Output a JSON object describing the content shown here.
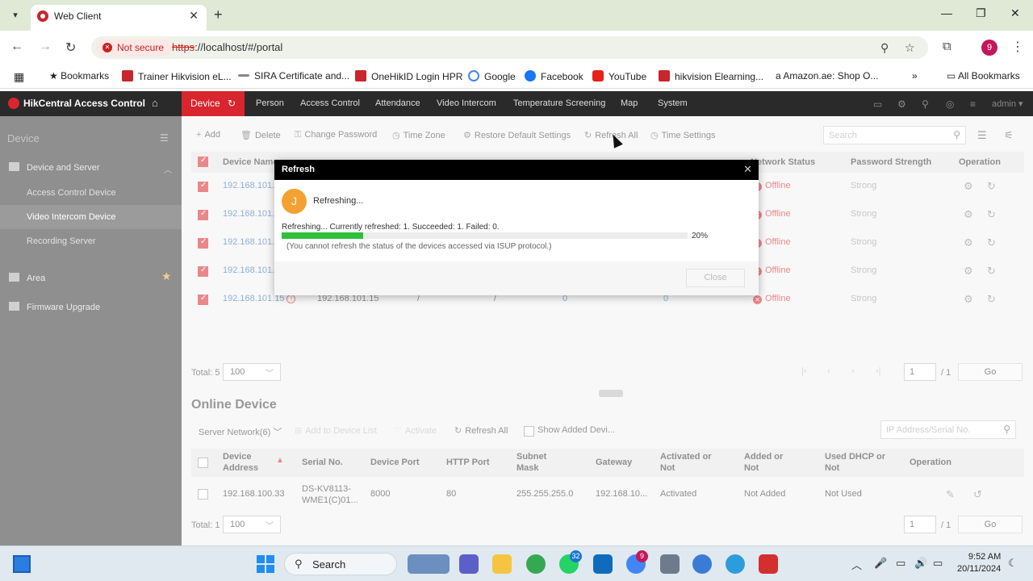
{
  "browser": {
    "tab_title": "Web Client",
    "not_secure": "Not secure",
    "url_proto": "https",
    "url_rest": "://localhost/#/portal",
    "profile_initial": "9",
    "bookmarks": [
      {
        "label": "Bookmarks",
        "color": "#222"
      },
      {
        "label": "Trainer Hikvision eL...",
        "color": "#c9252c"
      },
      {
        "label": "SIRA Certificate and...",
        "color": "#888"
      },
      {
        "label": "OneHikID Login HPR",
        "color": "#c9252c"
      },
      {
        "label": "Google",
        "color": "#4285f4"
      },
      {
        "label": "Facebook",
        "color": "#1877f2"
      },
      {
        "label": "YouTube",
        "color": "#e62117"
      },
      {
        "label": "hikvision Elearning...",
        "color": "#c9252c"
      },
      {
        "label": "Amazon.ae: Shop O...",
        "color": "#222"
      }
    ],
    "all_bookmarks": "All Bookmarks"
  },
  "app": {
    "name": "HikCentral Access Control",
    "nav": [
      "Device",
      "Person",
      "Access Control",
      "Attendance",
      "Video Intercom",
      "Temperature Screening",
      "Map",
      "System"
    ],
    "user": "admin"
  },
  "sidebar": {
    "title": "Device",
    "group1": "Device and Server",
    "items": [
      "Access Control Device",
      "Video Intercom Device",
      "Recording Server"
    ],
    "group2": "Area",
    "group3": "Firmware Upgrade"
  },
  "toolbar": {
    "add": "Add",
    "delete": "Delete",
    "change_password": "Change Password",
    "time_zone": "Time Zone",
    "restore": "Restore Default Settings",
    "refresh_all": "Refresh All",
    "time_settings": "Time Settings",
    "search_placeholder": "Search"
  },
  "device_table": {
    "headers": {
      "name": "Device Name",
      "network": "Network Status",
      "password": "Password Strength",
      "operation": "Operation"
    },
    "rows": [
      {
        "name": "192.168.101.1",
        "status": "Offline",
        "strength": "Strong"
      },
      {
        "name": "192.168.101.1",
        "status": "Offline",
        "strength": "Strong"
      },
      {
        "name": "192.168.101.1",
        "status": "Offline",
        "strength": "Strong"
      },
      {
        "name": "192.168.101.1",
        "status": "Offline",
        "strength": "Strong"
      },
      {
        "name": "192.168.101.15",
        "address": "192.168.101.15",
        "c3": "/",
        "c4": "/",
        "c5": "0",
        "c6": "0",
        "status": "Offline",
        "strength": "Strong"
      }
    ],
    "total": "Total: 5",
    "page_size": "100",
    "page": "1",
    "of_pages": "/ 1",
    "go": "Go"
  },
  "online": {
    "title": "Online Device",
    "server_network": "Server Network(6)",
    "add_to_list": "Add to Device List",
    "activate": "Activate",
    "refresh_all": "Refresh All",
    "show_added": "Show Added Devi...",
    "search_placeholder": "IP Address/Serial No.",
    "headers": {
      "address": "Device Address",
      "serial": "Serial No.",
      "port": "Device Port",
      "http": "HTTP Port",
      "mask": "Subnet Mask",
      "gateway": "Gateway",
      "activated": "Activated or Not",
      "added": "Added or Not",
      "dhcp": "Used DHCP or Not",
      "operation": "Operation"
    },
    "row": {
      "address": "192.168.100.33",
      "serial": "DS-KV8113-WME1(C)01...",
      "port": "8000",
      "http": "80",
      "mask": "255.255.255.0",
      "gateway": "192.168.10...",
      "activated": "Activated",
      "added": "Not Added",
      "dhcp": "Not Used"
    },
    "total": "Total: 1",
    "page_size": "100",
    "page": "1",
    "of_pages": "/ 1",
    "go": "Go"
  },
  "modal": {
    "title": "Refresh",
    "avatar": "J",
    "message": "Refreshing...",
    "status": "Refreshing... Currently refreshed: 1. Succeeded: 1. Failed: 0.",
    "progress_percent": 20,
    "progress_label": "20%",
    "note": "(You cannot refresh the status of the devices accessed via ISUP protocol.)",
    "close": "Close"
  },
  "taskbar": {
    "search": "Search",
    "teams_badge": "32",
    "chrome_badge": "9",
    "time": "9:52 AM",
    "date": "20/11/2024"
  },
  "colors": {
    "accent": "#d9252d",
    "progress": "#2fbf3a",
    "link": "#2f6db5"
  }
}
